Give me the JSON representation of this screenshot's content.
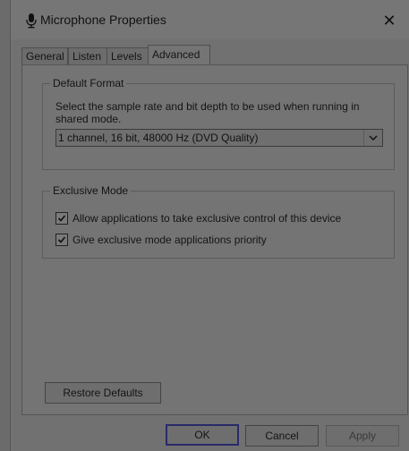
{
  "window": {
    "title": "Microphone Properties",
    "close_icon": "close-icon",
    "title_icon": "microphone-icon"
  },
  "tabs": [
    {
      "label": "General",
      "active": false
    },
    {
      "label": "Listen",
      "active": false
    },
    {
      "label": "Levels",
      "active": false
    },
    {
      "label": "Advanced",
      "active": true
    }
  ],
  "default_format": {
    "legend": "Default Format",
    "description": "Select the sample rate and bit depth to be used when running in shared mode.",
    "selected_format": "1 channel, 16 bit, 48000 Hz (DVD Quality)"
  },
  "exclusive_mode": {
    "legend": "Exclusive Mode",
    "options": [
      {
        "label": "Allow applications to take exclusive control of this device",
        "checked": true
      },
      {
        "label": "Give exclusive mode applications priority",
        "checked": true
      }
    ]
  },
  "buttons": {
    "restore_defaults": "Restore Defaults",
    "ok": "OK",
    "cancel": "Cancel",
    "apply": "Apply"
  }
}
